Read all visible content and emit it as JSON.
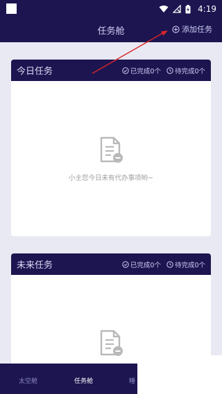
{
  "status_bar": {
    "time": "4:19"
  },
  "header": {
    "title": "任务舱",
    "add_task_label": "添加任务"
  },
  "today_card": {
    "title": "今日任务",
    "done_label": "已完成0个",
    "pending_label": "待完成0个",
    "empty_message": "小主您今日未有代办事项哟~"
  },
  "future_card": {
    "title": "未来任务",
    "done_label": "已完成0个",
    "pending_label": "待完成0个"
  },
  "bottom_nav": {
    "items": [
      {
        "label": "太空舱"
      },
      {
        "label": "任务舱"
      },
      {
        "label": "睡"
      }
    ]
  },
  "colors": {
    "header_bg": "#1c1550",
    "page_bg": "#e9e9f3",
    "annotation_arrow": "#d9262c"
  }
}
